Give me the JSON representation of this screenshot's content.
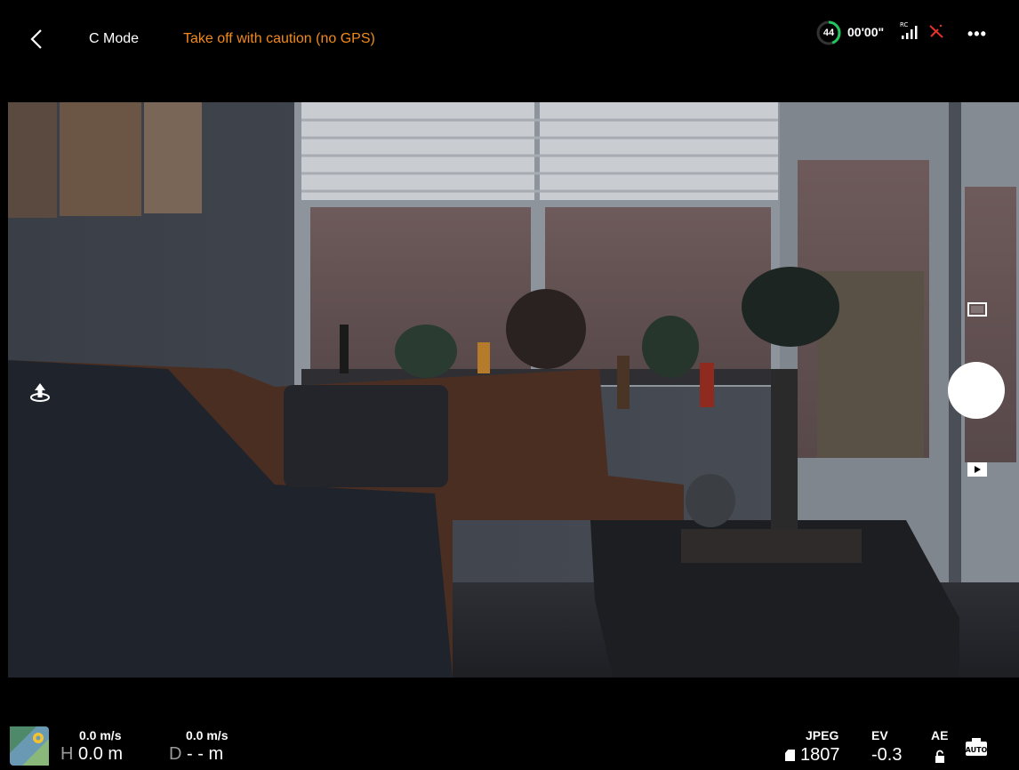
{
  "topbar": {
    "mode": "C Mode",
    "warning": "Take off with caution (no GPS)",
    "battery_percent": "44",
    "flight_time": "00'00\"",
    "rc_label": "RC",
    "more": "•••"
  },
  "bottombar": {
    "vertical_speed": "0.0 m/s",
    "height_label": "H",
    "height_value": "0.0 m",
    "horizontal_speed": "0.0 m/s",
    "distance_label": "D",
    "distance_value": "- - m",
    "format_label": "JPEG",
    "photos_remaining": "1807",
    "ev_label": "EV",
    "ev_value": "-0.3",
    "ae_label": "AE",
    "camera_mode": "AUTO"
  },
  "colors": {
    "warning": "#f28a1c",
    "battery_ring": "#22c55e",
    "gps_alert": "#e5322d"
  }
}
